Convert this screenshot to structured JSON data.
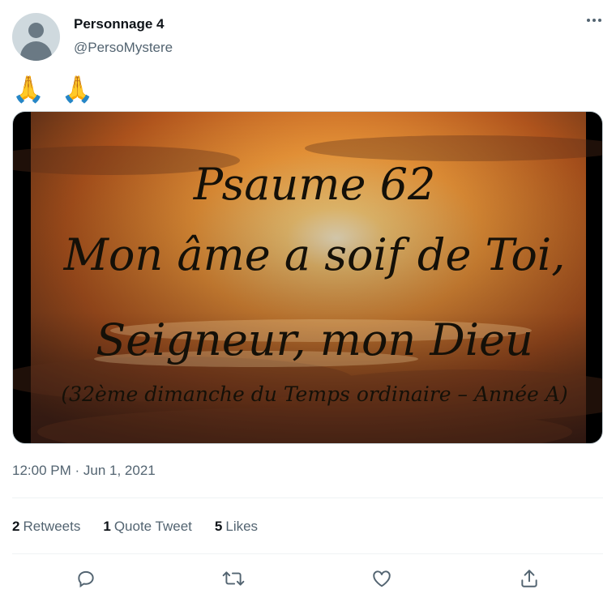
{
  "author": {
    "name": "Personnage 4",
    "handle": "@PersoMystere"
  },
  "tweet": {
    "text": "🙏 🙏",
    "media": {
      "line1": "Psaume 62",
      "line2": "Mon âme a soif de Toi,",
      "line3": "Seigneur, mon Dieu",
      "line4": "(32ème dimanche du Temps ordinaire – Année A)"
    },
    "timestamp": "12:00 PM · Jun 1, 2021"
  },
  "stats": {
    "retweets_count": "2",
    "retweets_label": "Retweets",
    "quotes_count": "1",
    "quotes_label": "Quote Tweet",
    "likes_count": "5",
    "likes_label": "Likes"
  },
  "actions": [
    "reply-icon",
    "retweet-icon",
    "like-icon",
    "share-icon"
  ],
  "colors": {
    "text_primary": "#0f1419",
    "text_secondary": "#536471",
    "divider": "#eff3f4"
  }
}
